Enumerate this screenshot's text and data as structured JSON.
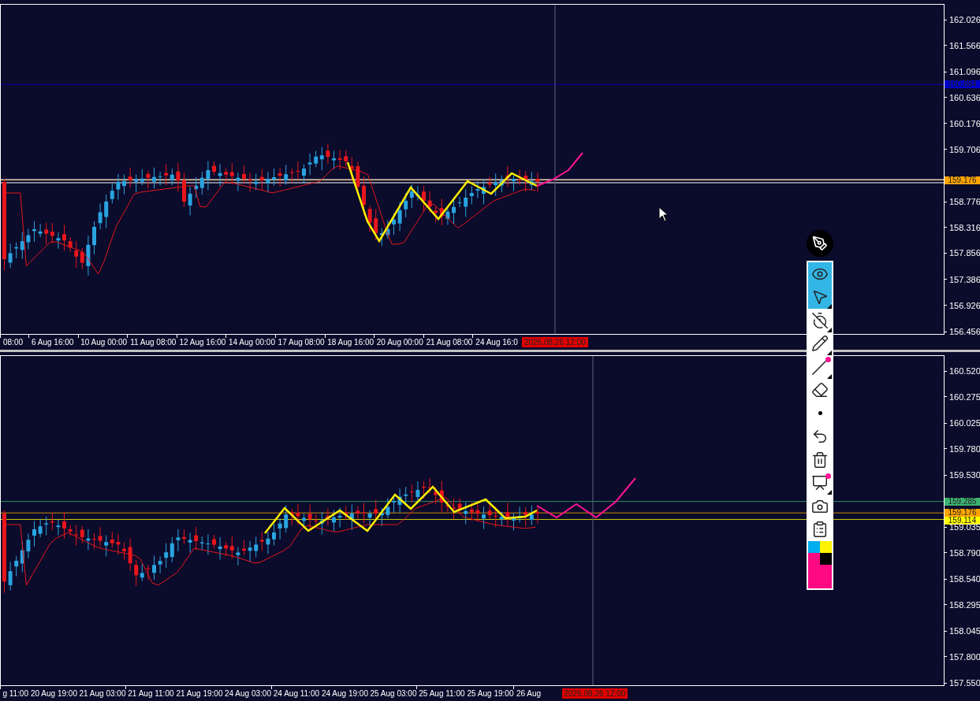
{
  "panels": [
    {
      "price_ticks": [
        "162.026",
        "161.566",
        "161.096",
        "160.636",
        "160.176",
        "159.706",
        "158.776",
        "158.316",
        "157.856",
        "157.386",
        "156.926",
        "156.456"
      ],
      "price_labels": [
        {
          "text": "160.884",
          "color": "#0000cc"
        },
        {
          "text": "159.176",
          "color": "#ffa500"
        }
      ],
      "time_labels": [
        "08:00",
        "6 Aug 16:00",
        "10 Aug 00:00",
        "11 Aug 08:00",
        "12 Aug 16:00",
        "14 Aug 00:00",
        "17 Aug 08:00",
        "18 Aug 16:00",
        "20 Aug 00:00",
        "21 Aug 08:00",
        "24 Aug 16:0"
      ],
      "cursor_time": "2026.08.26 12:00"
    },
    {
      "price_ticks": [
        "160.520",
        "160.275",
        "160.025",
        "159.780",
        "159.530",
        "159.035",
        "158.790",
        "158.540",
        "158.295",
        "158.045",
        "157.800",
        "157.550"
      ],
      "price_labels": [
        {
          "text": "159.285",
          "color": "#3cb371"
        },
        {
          "text": "159.176",
          "color": "#ffa500"
        },
        {
          "text": "159.114",
          "color": "#ffff00"
        }
      ],
      "time_labels": [
        "g 11:00",
        "20 Aug 19:00",
        "21 Aug 03:00",
        "21 Aug 11:00",
        "21 Aug 19:00",
        "24 Aug 03:00",
        "24 Aug 11:00",
        "24 Aug 19:00",
        "25 Aug 03:00",
        "25 Aug 11:00",
        "25 Aug 19:00",
        "26 Aug"
      ],
      "cursor_time": "2026.08.26 12:00"
    }
  ],
  "toolbar": {
    "tools": [
      {
        "kind": "eye",
        "selected": true,
        "submenu": false,
        "badge": false
      },
      {
        "kind": "pointer",
        "selected": true,
        "submenu": true,
        "badge": false
      },
      {
        "kind": "timer-off",
        "selected": false,
        "submenu": true,
        "badge": false
      },
      {
        "kind": "pencil",
        "selected": false,
        "submenu": true,
        "badge": false
      },
      {
        "kind": "line",
        "selected": false,
        "submenu": true,
        "badge": true
      },
      {
        "kind": "eraser",
        "selected": false,
        "submenu": false,
        "badge": false
      },
      {
        "kind": "dot",
        "selected": false,
        "submenu": false,
        "badge": false
      },
      {
        "kind": "undo",
        "selected": false,
        "submenu": false,
        "badge": false
      },
      {
        "kind": "trash",
        "selected": false,
        "submenu": false,
        "badge": false
      },
      {
        "kind": "easel",
        "selected": false,
        "submenu": true,
        "badge": true
      },
      {
        "kind": "camera",
        "selected": false,
        "submenu": false,
        "badge": false
      },
      {
        "kind": "clipboard",
        "selected": false,
        "submenu": false,
        "badge": false
      }
    ],
    "swatches": [
      {
        "color": "#00aeef"
      },
      {
        "color": "#fff200"
      },
      {
        "color": "#ff0a84"
      },
      {
        "color": "#000000"
      },
      {
        "color": "#ff0a84"
      }
    ]
  }
}
